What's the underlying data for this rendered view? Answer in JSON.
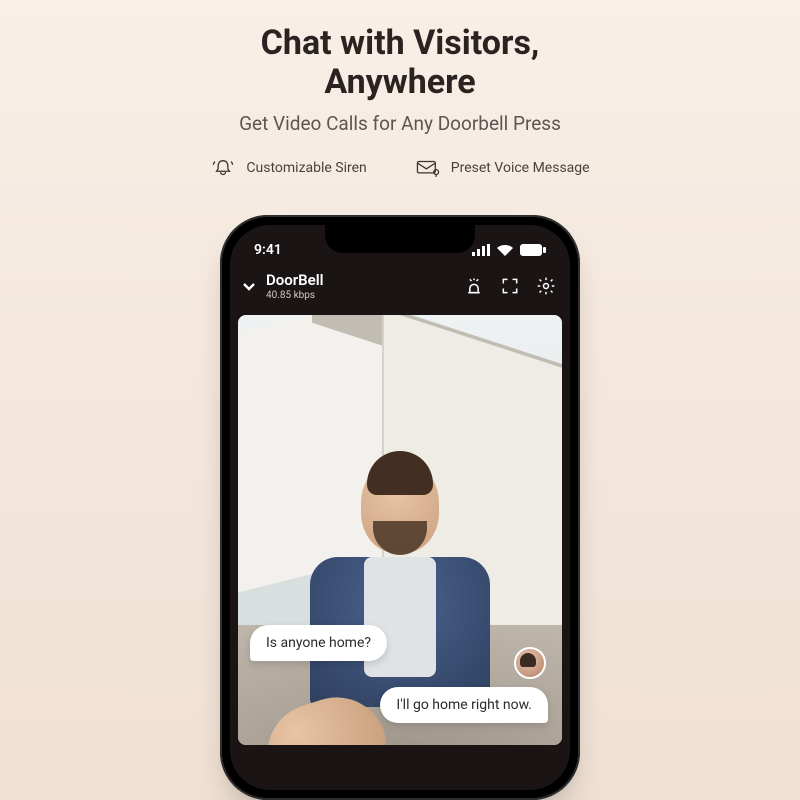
{
  "hero": {
    "title_line1": "Chat with Visitors,",
    "title_line2": "Anywhere",
    "subtitle": "Get Video Calls for Any Doorbell Press"
  },
  "features": {
    "siren": "Customizable Siren",
    "voice": "Preset Voice Message"
  },
  "status": {
    "time": "9:41"
  },
  "appbar": {
    "device_name": "DoorBell",
    "bitrate": "40.85 kbps"
  },
  "chat": {
    "visitor_msg": "Is anyone home?",
    "user_msg": "I'll go home right now."
  }
}
